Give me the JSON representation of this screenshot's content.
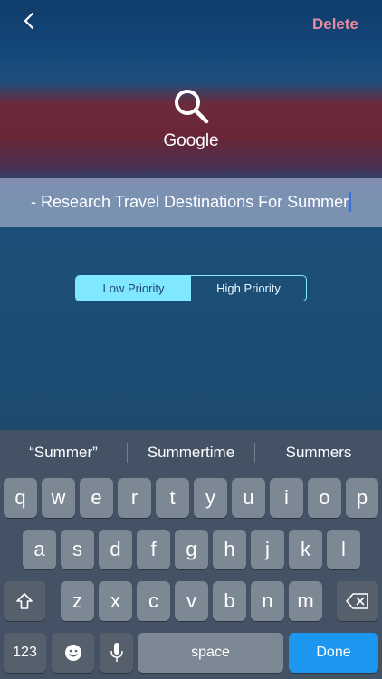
{
  "header": {
    "back_icon": "chevron-left-icon",
    "delete_label": "Delete"
  },
  "app": {
    "icon": "search-icon",
    "name": "Google"
  },
  "task": {
    "text": "- Research Travel Destinations For Summer"
  },
  "priority": {
    "options": [
      "Low Priority",
      "High Priority"
    ],
    "selected": "Low Priority"
  },
  "keyboard": {
    "suggestions": [
      "“Summer”",
      "Summertime",
      "Summers"
    ],
    "row1": [
      "q",
      "w",
      "e",
      "r",
      "t",
      "y",
      "u",
      "i",
      "o",
      "p"
    ],
    "row2": [
      "a",
      "s",
      "d",
      "f",
      "g",
      "h",
      "j",
      "k",
      "l"
    ],
    "row3": [
      "z",
      "x",
      "c",
      "v",
      "b",
      "n",
      "m"
    ],
    "numbers_label": "123",
    "space_label": "space",
    "done_label": "Done",
    "shift_icon": "shift-icon",
    "backspace_icon": "backspace-icon",
    "emoji_icon": "emoji-icon",
    "mic_icon": "microphone-icon"
  }
}
